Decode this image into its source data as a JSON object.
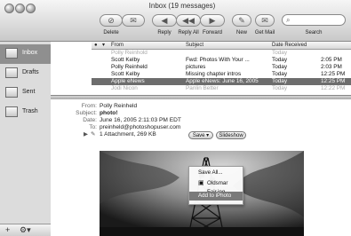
{
  "window": {
    "title": "Inbox (19 messages)"
  },
  "toolbar": {
    "buttons": [
      {
        "label": "Delete",
        "icon": "delete-icon"
      },
      {
        "label": "Junk",
        "icon": "junk-icon"
      },
      {
        "label": "Reply",
        "icon": "reply-icon"
      },
      {
        "label": "Reply All",
        "icon": "reply-all-icon"
      },
      {
        "label": "Forward",
        "icon": "forward-icon"
      },
      {
        "label": "New",
        "icon": "new-message-icon"
      },
      {
        "label": "Get Mail",
        "icon": "get-mail-icon"
      }
    ],
    "search_label": "Search",
    "search_placeholder": ""
  },
  "sidebar": {
    "mailboxes": [
      {
        "label": "Inbox",
        "selected": true,
        "icon": "inbox-icon"
      },
      {
        "label": "Drafts",
        "selected": false,
        "icon": "drafts-icon"
      },
      {
        "label": "Sent",
        "selected": false,
        "icon": "sent-icon"
      },
      {
        "label": "Trash",
        "selected": false,
        "icon": "trash-icon"
      }
    ]
  },
  "message_list": {
    "columns": {
      "from": "From",
      "subject": "Subject",
      "date": "Date Received"
    },
    "rows": [
      {
        "from": "Polly Reinhold",
        "subject": "",
        "date_day": "Today",
        "date_time": "",
        "state": "faded"
      },
      {
        "from": "Scott Kelby",
        "subject": "Fwd: Photos With Your ...",
        "date_day": "Today",
        "date_time": "2:05 PM",
        "state": "normal"
      },
      {
        "from": "Polly Reinheld",
        "subject": "pictures",
        "date_day": "Today",
        "date_time": "2:03 PM",
        "state": "normal"
      },
      {
        "from": "Scott Kelby",
        "subject": "Missing chapter intros",
        "date_day": "Today",
        "date_time": "12:25 PM",
        "state": "normal"
      },
      {
        "from": "Apple eNews",
        "subject": "Apple eNews: June 16, 2005",
        "date_day": "Today",
        "date_time": "12:25 PM",
        "state": "selected"
      },
      {
        "from": "Jodi Nicon",
        "subject": "Panlin Better",
        "date_day": "Today",
        "date_time": "12:22 PM",
        "state": "faded"
      }
    ]
  },
  "preview": {
    "labels": {
      "from": "From:",
      "subject": "Subject:",
      "date": "Date:",
      "to": "To:"
    },
    "from": "Polly Reinheld",
    "subject": "photo!",
    "date": "June 16, 2005 2:11:03 PM EDT",
    "to": "preinheld@photoshopuser.com",
    "attachment": "1 Attachment, 269 KB",
    "save_button": "Save",
    "slideshow_button": "Slideshow"
  },
  "save_menu": {
    "items": [
      {
        "label": "Save All...",
        "highlighted": false
      },
      {
        "label": "Oldsmar Fair.jpg",
        "highlighted": false
      },
      {
        "label": "Add to iPhoto",
        "highlighted": true
      }
    ]
  },
  "colors": {
    "selection": "#6d6d6d",
    "sidebar_bg": "#dcdcdc"
  }
}
